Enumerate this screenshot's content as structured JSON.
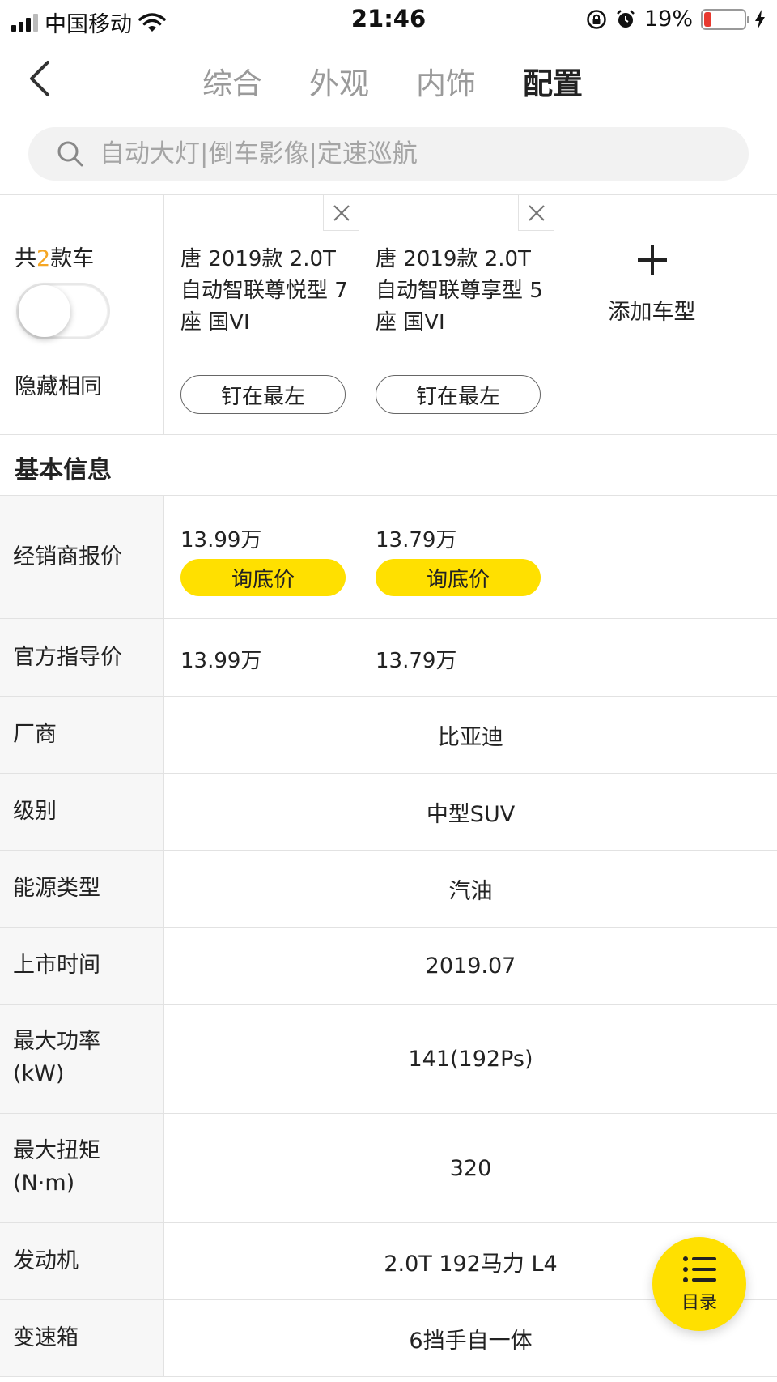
{
  "status_bar": {
    "carrier": "中国移动",
    "time": "21:46",
    "battery": "19%",
    "battery_level": 0.19,
    "battery_color": "#e8392f"
  },
  "nav": {
    "back_icon": "chevron-left-icon",
    "tabs": [
      {
        "label": "综合",
        "active": false
      },
      {
        "label": "外观",
        "active": false
      },
      {
        "label": "内饰",
        "active": false
      },
      {
        "label": "配置",
        "active": true
      }
    ]
  },
  "search": {
    "placeholder": "自动大灯|倒车影像|定速巡航",
    "value": ""
  },
  "compare": {
    "count_prefix": "共",
    "count": "2",
    "count_suffix": "款车",
    "hide_same_label": "隐藏相同",
    "hide_same_on": false,
    "cars": [
      {
        "name": "唐 2019款 2.0T 自动智联尊悦型 7座 国VI",
        "pin_label": "钉在最左"
      },
      {
        "name": "唐 2019款 2.0T 自动智联尊享型 5座 国VI",
        "pin_label": "钉在最左"
      }
    ],
    "add_label": "添加车型"
  },
  "section": {
    "title": "基本信息"
  },
  "rows": {
    "dealer_price": {
      "label": "经销商报价",
      "values": [
        "13.99万",
        "13.79万"
      ],
      "button": "询底价"
    },
    "official_price": {
      "label": "官方指导价",
      "values": [
        "13.99万",
        "13.79万"
      ]
    },
    "maker": {
      "label": "厂商",
      "value": "比亚迪"
    },
    "level": {
      "label": "级别",
      "value": "中型SUV"
    },
    "energy": {
      "label": "能源类型",
      "value": "汽油"
    },
    "launch": {
      "label": "上市时间",
      "value": "2019.07"
    },
    "power": {
      "label_1": "最大功率",
      "label_2": "(kW)",
      "value": "141(192Ps)"
    },
    "torque": {
      "label_1": "最大扭矩",
      "label_2": "(N·m)",
      "value": "320"
    },
    "engine": {
      "label": "发动机",
      "value": "2.0T 192马力 L4"
    },
    "gearbox": {
      "label": "变速箱",
      "value": "6挡手自一体"
    }
  },
  "toc": {
    "label": "目录",
    "icon": "list-icon"
  },
  "colors": {
    "accent_yellow": "#ffe000",
    "count_orange": "#f5a623"
  }
}
